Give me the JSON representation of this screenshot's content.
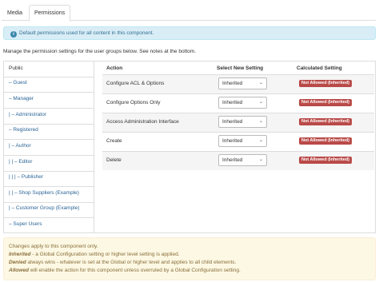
{
  "tabs": [
    {
      "label": "Media"
    },
    {
      "label": "Permissions"
    }
  ],
  "info": {
    "text": "Default permissions used for all content in this component.",
    "icon": "info-icon"
  },
  "manage_text": "Manage the permission settings for the user groups below. See notes at the bottom.",
  "groups": [
    {
      "label": "Public"
    },
    {
      "label": "– Guest"
    },
    {
      "label": "– Manager"
    },
    {
      "label": "|   – Administrator"
    },
    {
      "label": "– Registered"
    },
    {
      "label": "|   – Author"
    },
    {
      "label": "|   |   – Editor"
    },
    {
      "label": "|   |   |   – Publisher"
    },
    {
      "label": "|   |   – Shop Suppliers (Example)"
    },
    {
      "label": "|   – Customer Group (Example)"
    },
    {
      "label": "– Super Users"
    }
  ],
  "table": {
    "headers": {
      "action": "Action",
      "new_setting": "Select New Setting",
      "calculated": "Calculated Setting"
    },
    "rows": [
      {
        "action": "Configure ACL & Options",
        "setting": "Inherited",
        "calculated": "Not Allowed (Inherited)"
      },
      {
        "action": "Configure Options Only",
        "setting": "Inherited",
        "calculated": "Not Allowed (Inherited)"
      },
      {
        "action": "Access Administration Interface",
        "setting": "Inherited",
        "calculated": "Not Allowed (Inherited)"
      },
      {
        "action": "Create",
        "setting": "Inherited",
        "calculated": "Not Allowed (Inherited)"
      },
      {
        "action": "Delete",
        "setting": "Inherited",
        "calculated": "Not Allowed (Inherited)"
      }
    ]
  },
  "notes": {
    "line1": "Changes apply to this component only.",
    "inherited_label": "Inherited",
    "inherited_text": " - a Global Configuration setting or higher level setting is applied.",
    "denied_label": "Denied",
    "denied_text": " always wins - whatever is set at the Global or higher level and applies to all child elements.",
    "allowed_label": "Allowed",
    "allowed_text": " will enable the action for this component unless overruled by a Global Configuration setting."
  },
  "colors": {
    "badge": "#b94a48",
    "info_bg": "#d9edf7",
    "notes_bg": "#fcf8e3",
    "link": "#2a6496"
  }
}
